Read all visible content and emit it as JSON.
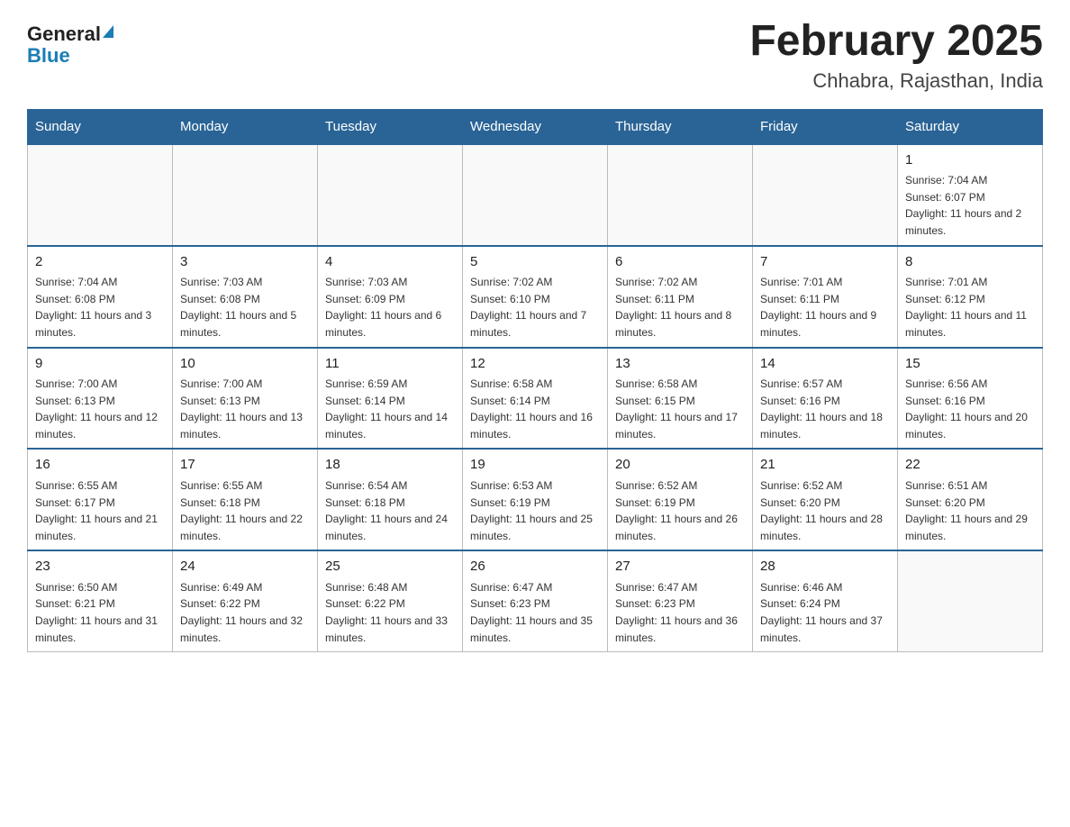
{
  "logo": {
    "general": "General",
    "arrow": "▶",
    "blue": "Blue"
  },
  "title": "February 2025",
  "subtitle": "Chhabra, Rajasthan, India",
  "weekdays": [
    "Sunday",
    "Monday",
    "Tuesday",
    "Wednesday",
    "Thursday",
    "Friday",
    "Saturday"
  ],
  "weeks": [
    [
      {
        "day": "",
        "info": ""
      },
      {
        "day": "",
        "info": ""
      },
      {
        "day": "",
        "info": ""
      },
      {
        "day": "",
        "info": ""
      },
      {
        "day": "",
        "info": ""
      },
      {
        "day": "",
        "info": ""
      },
      {
        "day": "1",
        "info": "Sunrise: 7:04 AM\nSunset: 6:07 PM\nDaylight: 11 hours and 2 minutes."
      }
    ],
    [
      {
        "day": "2",
        "info": "Sunrise: 7:04 AM\nSunset: 6:08 PM\nDaylight: 11 hours and 3 minutes."
      },
      {
        "day": "3",
        "info": "Sunrise: 7:03 AM\nSunset: 6:08 PM\nDaylight: 11 hours and 5 minutes."
      },
      {
        "day": "4",
        "info": "Sunrise: 7:03 AM\nSunset: 6:09 PM\nDaylight: 11 hours and 6 minutes."
      },
      {
        "day": "5",
        "info": "Sunrise: 7:02 AM\nSunset: 6:10 PM\nDaylight: 11 hours and 7 minutes."
      },
      {
        "day": "6",
        "info": "Sunrise: 7:02 AM\nSunset: 6:11 PM\nDaylight: 11 hours and 8 minutes."
      },
      {
        "day": "7",
        "info": "Sunrise: 7:01 AM\nSunset: 6:11 PM\nDaylight: 11 hours and 9 minutes."
      },
      {
        "day": "8",
        "info": "Sunrise: 7:01 AM\nSunset: 6:12 PM\nDaylight: 11 hours and 11 minutes."
      }
    ],
    [
      {
        "day": "9",
        "info": "Sunrise: 7:00 AM\nSunset: 6:13 PM\nDaylight: 11 hours and 12 minutes."
      },
      {
        "day": "10",
        "info": "Sunrise: 7:00 AM\nSunset: 6:13 PM\nDaylight: 11 hours and 13 minutes."
      },
      {
        "day": "11",
        "info": "Sunrise: 6:59 AM\nSunset: 6:14 PM\nDaylight: 11 hours and 14 minutes."
      },
      {
        "day": "12",
        "info": "Sunrise: 6:58 AM\nSunset: 6:14 PM\nDaylight: 11 hours and 16 minutes."
      },
      {
        "day": "13",
        "info": "Sunrise: 6:58 AM\nSunset: 6:15 PM\nDaylight: 11 hours and 17 minutes."
      },
      {
        "day": "14",
        "info": "Sunrise: 6:57 AM\nSunset: 6:16 PM\nDaylight: 11 hours and 18 minutes."
      },
      {
        "day": "15",
        "info": "Sunrise: 6:56 AM\nSunset: 6:16 PM\nDaylight: 11 hours and 20 minutes."
      }
    ],
    [
      {
        "day": "16",
        "info": "Sunrise: 6:55 AM\nSunset: 6:17 PM\nDaylight: 11 hours and 21 minutes."
      },
      {
        "day": "17",
        "info": "Sunrise: 6:55 AM\nSunset: 6:18 PM\nDaylight: 11 hours and 22 minutes."
      },
      {
        "day": "18",
        "info": "Sunrise: 6:54 AM\nSunset: 6:18 PM\nDaylight: 11 hours and 24 minutes."
      },
      {
        "day": "19",
        "info": "Sunrise: 6:53 AM\nSunset: 6:19 PM\nDaylight: 11 hours and 25 minutes."
      },
      {
        "day": "20",
        "info": "Sunrise: 6:52 AM\nSunset: 6:19 PM\nDaylight: 11 hours and 26 minutes."
      },
      {
        "day": "21",
        "info": "Sunrise: 6:52 AM\nSunset: 6:20 PM\nDaylight: 11 hours and 28 minutes."
      },
      {
        "day": "22",
        "info": "Sunrise: 6:51 AM\nSunset: 6:20 PM\nDaylight: 11 hours and 29 minutes."
      }
    ],
    [
      {
        "day": "23",
        "info": "Sunrise: 6:50 AM\nSunset: 6:21 PM\nDaylight: 11 hours and 31 minutes."
      },
      {
        "day": "24",
        "info": "Sunrise: 6:49 AM\nSunset: 6:22 PM\nDaylight: 11 hours and 32 minutes."
      },
      {
        "day": "25",
        "info": "Sunrise: 6:48 AM\nSunset: 6:22 PM\nDaylight: 11 hours and 33 minutes."
      },
      {
        "day": "26",
        "info": "Sunrise: 6:47 AM\nSunset: 6:23 PM\nDaylight: 11 hours and 35 minutes."
      },
      {
        "day": "27",
        "info": "Sunrise: 6:47 AM\nSunset: 6:23 PM\nDaylight: 11 hours and 36 minutes."
      },
      {
        "day": "28",
        "info": "Sunrise: 6:46 AM\nSunset: 6:24 PM\nDaylight: 11 hours and 37 minutes."
      },
      {
        "day": "",
        "info": ""
      }
    ]
  ]
}
